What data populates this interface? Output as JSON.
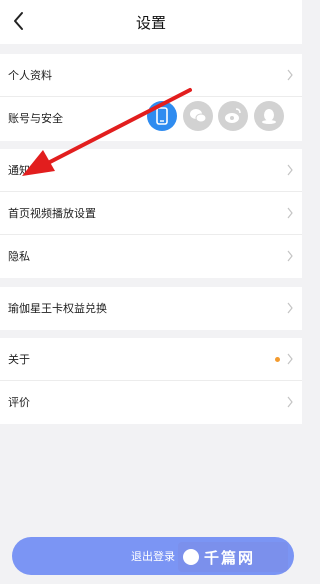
{
  "header": {
    "title": "设置",
    "back_icon": "chevron-left-icon"
  },
  "groups": [
    {
      "rows": [
        "个人资料",
        "账号与安全"
      ]
    },
    {
      "rows": [
        "通知",
        "首页视频播放设置",
        "隐私"
      ]
    },
    {
      "rows": [
        "瑜伽星王卡权益兑换"
      ]
    },
    {
      "rows": [
        "关于",
        "评价"
      ]
    }
  ],
  "account_icons": [
    "phone-icon",
    "wechat-icon",
    "weibo-icon",
    "qq-icon"
  ],
  "colors": {
    "accent_blue": "#2f8cf0",
    "muted_icon": "#d2d2d2",
    "notify_dot": "#f39b2f",
    "annotation_arrow": "#e21e1e",
    "logout_button": "#7b95f4"
  },
  "logout": {
    "label": "退出登录"
  },
  "watermark": {
    "text": "千篇网"
  }
}
